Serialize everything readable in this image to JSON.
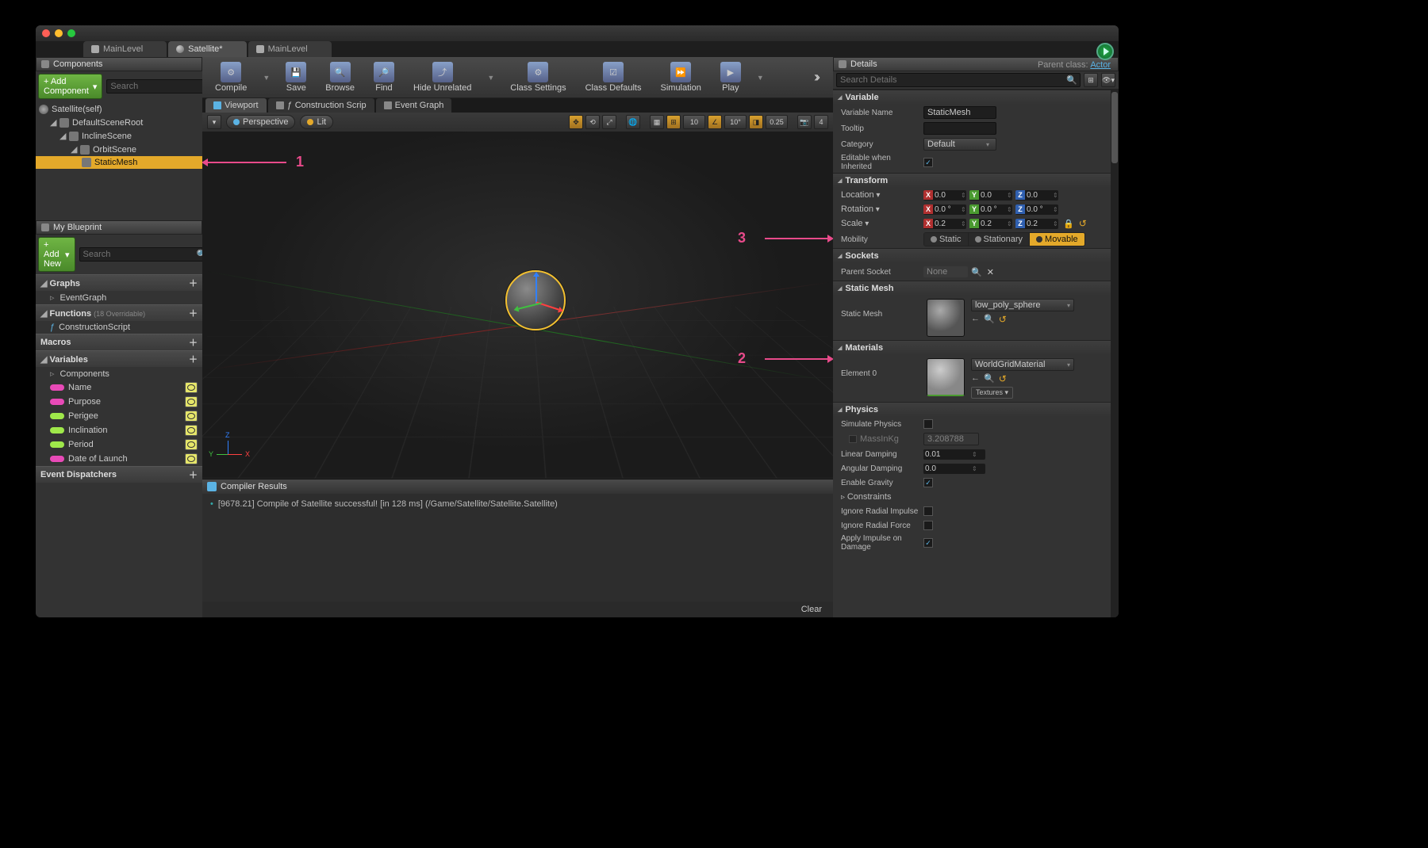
{
  "tabs": {
    "items": [
      {
        "label": "MainLevel",
        "icon": "level"
      },
      {
        "label": "Satellite*",
        "icon": "sphere"
      },
      {
        "label": "MainLevel",
        "icon": "level"
      }
    ]
  },
  "parent_class": {
    "label": "Parent class:",
    "value": "Actor"
  },
  "components_panel": {
    "title": "Components",
    "add_button": "+ Add Component",
    "search_placeholder": "Search",
    "tree": {
      "root": "Satellite(self)",
      "default_scene_root": "DefaultSceneRoot",
      "incline_scene": "InclineScene",
      "orbit_scene": "OrbitScene",
      "static_mesh": "StaticMesh"
    }
  },
  "my_blueprint": {
    "title": "My Blueprint",
    "add_new": "+ Add New",
    "search_placeholder": "Search",
    "sections": {
      "graphs": "Graphs",
      "event_graph": "EventGraph",
      "functions": "Functions",
      "functions_suffix": "(18 Overridable)",
      "construction_script": "ConstructionScript",
      "macros": "Macros",
      "variables": "Variables",
      "components_item": "Components",
      "vars": [
        {
          "name": "Name",
          "color": "magenta"
        },
        {
          "name": "Purpose",
          "color": "magenta"
        },
        {
          "name": "Perigee",
          "color": "lime"
        },
        {
          "name": "Inclination",
          "color": "lime"
        },
        {
          "name": "Period",
          "color": "lime"
        },
        {
          "name": "Date of Launch",
          "color": "magenta"
        }
      ],
      "event_dispatchers": "Event Dispatchers"
    }
  },
  "toolbar": {
    "compile": "Compile",
    "save": "Save",
    "browse": "Browse",
    "find": "Find",
    "hide_unrelated": "Hide Unrelated",
    "class_settings": "Class Settings",
    "class_defaults": "Class Defaults",
    "simulation": "Simulation",
    "play": "Play"
  },
  "subtabs": {
    "viewport": "Viewport",
    "construction": "Construction Scrip",
    "event_graph": "Event Graph"
  },
  "viewport_toolbar": {
    "perspective": "Perspective",
    "lit": "Lit",
    "snap_loc": "10",
    "snap_rot": "10°",
    "snap_scale": "0.25",
    "cam_speed": "4"
  },
  "compiler_results": {
    "title": "Compiler Results",
    "message": "[9678.21] Compile of Satellite successful! [in 128 ms] (/Game/Satellite/Satellite.Satellite)",
    "clear": "Clear"
  },
  "details": {
    "title": "Details",
    "search_placeholder": "Search Details",
    "variable": {
      "header": "Variable",
      "name_label": "Variable Name",
      "name_value": "StaticMesh",
      "tooltip_label": "Tooltip",
      "category_label": "Category",
      "category_value": "Default",
      "editable_label": "Editable when Inherited"
    },
    "transform": {
      "header": "Transform",
      "location_label": "Location",
      "rotation_label": "Rotation",
      "scale_label": "Scale",
      "mobility_label": "Mobility",
      "location": {
        "x": "0.0",
        "y": "0.0",
        "z": "0.0"
      },
      "rotation": {
        "x": "0.0 °",
        "y": "0.0 °",
        "z": "0.0 °"
      },
      "scale": {
        "x": "0.2",
        "y": "0.2",
        "z": "0.2"
      },
      "mobility": {
        "static": "Static",
        "stationary": "Stationary",
        "movable": "Movable"
      }
    },
    "sockets": {
      "header": "Sockets",
      "parent_socket_label": "Parent Socket",
      "value": "None"
    },
    "static_mesh": {
      "header": "Static Mesh",
      "label": "Static Mesh",
      "asset": "low_poly_sphere"
    },
    "materials": {
      "header": "Materials",
      "element0_label": "Element 0",
      "asset": "WorldGridMaterial",
      "textures": "Textures"
    },
    "physics": {
      "header": "Physics",
      "simulate_label": "Simulate Physics",
      "mass_label": "MassInKg",
      "mass_value": "3.208788",
      "linear_damping_label": "Linear Damping",
      "linear_damping_value": "0.01",
      "angular_damping_label": "Angular Damping",
      "angular_damping_value": "0.0",
      "enable_gravity_label": "Enable Gravity",
      "constraints_label": "Constraints",
      "ignore_radial_impulse": "Ignore Radial Impulse",
      "ignore_radial_force": "Ignore Radial Force",
      "apply_impulse": "Apply Impulse on Damage"
    }
  },
  "annotations": {
    "one": "1",
    "two": "2",
    "three": "3"
  }
}
